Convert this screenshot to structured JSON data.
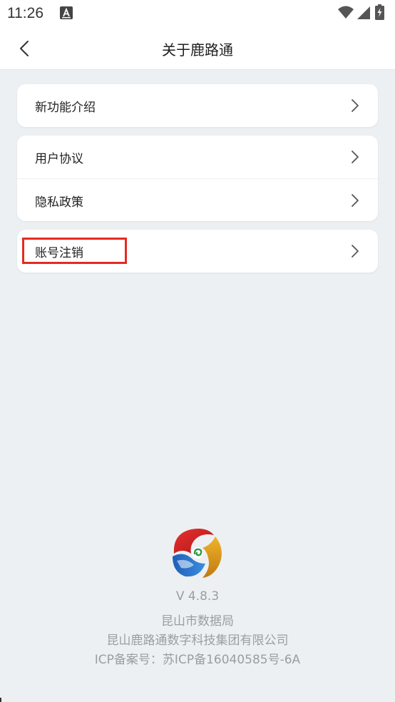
{
  "status_bar": {
    "time": "11:26",
    "notification_icon": "a-icon",
    "wifi_icon": "wifi-icon",
    "signal_icon": "signal-icon",
    "battery_icon": "battery-charging-icon"
  },
  "header": {
    "title": "关于鹿路通",
    "back_icon": "chevron-left-icon"
  },
  "cards": [
    {
      "items": [
        {
          "label": "新功能介绍"
        }
      ]
    },
    {
      "items": [
        {
          "label": "用户协议"
        },
        {
          "label": "隐私政策"
        }
      ]
    },
    {
      "items": [
        {
          "label": "账号注销",
          "highlighted": true
        }
      ]
    }
  ],
  "footer": {
    "version": "V 4.8.3",
    "org": "昆山市数据局",
    "company": "昆山鹿路通数字科技集团有限公司",
    "icp": "ICP备案号：苏ICP备16040585号-6A"
  },
  "colors": {
    "background": "#ecf0f3",
    "card": "#ffffff",
    "highlight": "#e52a22",
    "footer_text": "#9a9da2"
  }
}
